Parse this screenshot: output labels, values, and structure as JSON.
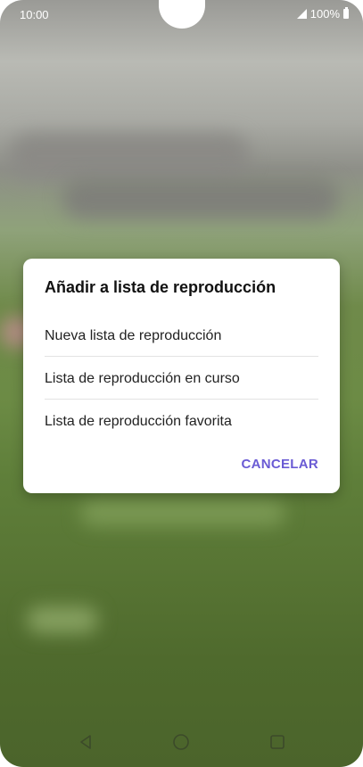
{
  "status_bar": {
    "time": "10:00",
    "battery": "100%"
  },
  "dialog": {
    "title": "Añadir a lista de reproducción",
    "options": [
      "Nueva lista de reproducción",
      "Lista de reproducción en curso",
      "Lista de reproducción favorita"
    ],
    "cancel_label": "CANCELAR"
  },
  "nav_bar": {
    "icons": [
      "back-icon",
      "home-icon",
      "recents-icon"
    ]
  },
  "colors": {
    "accent": "#6a5bd4"
  }
}
